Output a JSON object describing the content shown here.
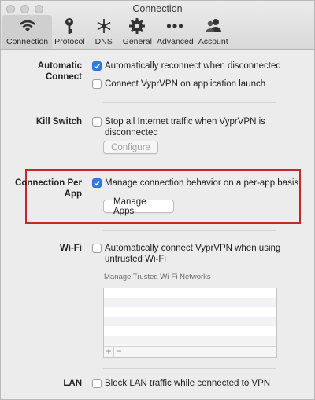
{
  "window": {
    "title": "Connection"
  },
  "tabs": [
    {
      "label": "Connection",
      "icon": "wifi-icon",
      "active": true
    },
    {
      "label": "Protocol",
      "icon": "key-icon"
    },
    {
      "label": "DNS",
      "icon": "dns-asterisk-icon"
    },
    {
      "label": "General",
      "icon": "gear-icon"
    },
    {
      "label": "Advanced",
      "icon": "more-dots-icon"
    },
    {
      "label": "Account",
      "icon": "account-users-icon"
    }
  ],
  "sections": {
    "automatic_connect": {
      "label": "Automatic Connect",
      "options": [
        {
          "text": "Automatically reconnect when disconnected",
          "checked": true
        },
        {
          "text": "Connect VyprVPN on application launch",
          "checked": false
        }
      ]
    },
    "kill_switch": {
      "label": "Kill Switch",
      "option": {
        "text": "Stop all Internet traffic when VyprVPN is disconnected",
        "checked": false
      },
      "button": "Configure"
    },
    "per_app": {
      "label": "Connection Per App",
      "option": {
        "text": "Manage connection behavior on a per-app basis",
        "checked": true
      },
      "button": "Manage Apps"
    },
    "wifi": {
      "label": "Wi-Fi",
      "option": {
        "text": "Automatically connect VyprVPN when using untrusted Wi-Fi",
        "checked": false
      },
      "list_caption": "Manage Trusted Wi-Fi Networks",
      "add_label": "+",
      "remove_label": "−"
    },
    "lan": {
      "label": "LAN",
      "option": {
        "text": "Block LAN traffic while connected to VPN",
        "checked": false
      }
    }
  },
  "colors": {
    "accent": "#2f7ae5",
    "highlight_border": "#c62828"
  }
}
